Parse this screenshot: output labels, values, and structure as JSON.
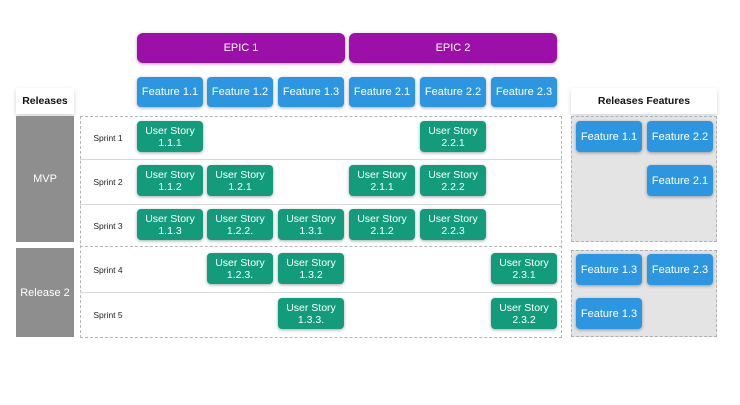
{
  "headers": {
    "releases": "Releases",
    "releases_features": "Releases Features"
  },
  "epics": [
    "EPIC 1",
    "EPIC 2"
  ],
  "features": [
    "Feature 1.1",
    "Feature 1.2",
    "Feature 1.3",
    "Feature 2.1",
    "Feature 2.2",
    "Feature 2.3"
  ],
  "releases": [
    "MVP",
    "Release 2"
  ],
  "sprints": [
    "Sprint 1",
    "Sprint 2",
    "Sprint 3",
    "Sprint 4",
    "Sprint 5"
  ],
  "stories": {
    "s1_f11": "User Story\n1.1.1",
    "s1_f22": "User Story\n2.2.1",
    "s2_f11": "User Story\n1.1.2",
    "s2_f12": "User Story\n1.2.1",
    "s2_f21": "User Story\n2.1.1",
    "s2_f22": "User Story\n2.2.2",
    "s3_f11": "User Story\n1.1.3",
    "s3_f12": "User Story\n1.2.2.",
    "s3_f13": "User Story\n1.3.1",
    "s3_f21": "User Story\n2.1.2",
    "s3_f22": "User Story\n2.2.3",
    "s4_f12": "User Story\n1.2.3.",
    "s4_f13": "User Story\n1.3.2",
    "s4_f23": "User Story\n2.3.1",
    "s5_f13": "User Story\n1.3.3.",
    "s5_f23": "User Story\n2.3.2"
  },
  "release_features": {
    "mvp": [
      "Feature 1.1",
      "Feature 2.2",
      "Feature 2.1"
    ],
    "release2": [
      "Feature 1.3",
      "Feature 2.3",
      "Feature 1.3"
    ]
  },
  "colors": {
    "epic": "#9c0fa8",
    "feature": "#2d96e0",
    "story": "#139c7c",
    "release": "#8e8e8e"
  }
}
